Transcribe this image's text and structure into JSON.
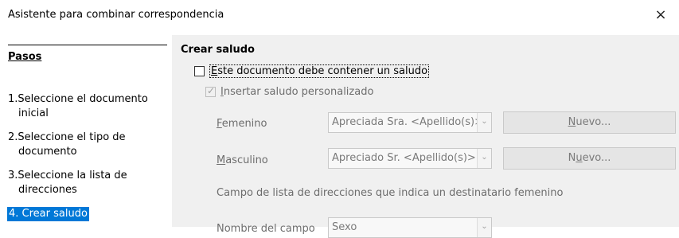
{
  "window": {
    "title": "Asistente para combinar correspondencia",
    "close_glyph": "×"
  },
  "sidebar": {
    "heading": "Pasos",
    "steps": [
      {
        "num": "1.",
        "line1": "Seleccione el documento",
        "line2": "inicial"
      },
      {
        "num": "2.",
        "line1": "Seleccione el tipo de",
        "line2": "documento"
      },
      {
        "num": "3.",
        "line1": "Seleccione la lista de",
        "line2": "direcciones"
      },
      {
        "num": "4.",
        "line1": "Crear saludo",
        "line2": ""
      }
    ],
    "active_step": 4,
    "active_color": "#0078d7"
  },
  "main": {
    "section_title": "Crear saludo",
    "greeting_checkbox": {
      "label_mnemonic": "E",
      "label_rest": "ste documento debe contener un saludo",
      "checked": false
    },
    "personalized_checkbox": {
      "label_mnemonic": "I",
      "label_rest": "nsertar saludo personalizado",
      "checked": true,
      "enabled": false
    },
    "female": {
      "label_mnemonic": "F",
      "label_rest": "emenino",
      "combo_value": "Apreciada Sra. <Apellido(s)>",
      "button_mnemonic": "N",
      "button_rest": "uevo..."
    },
    "male": {
      "label_mnemonic": "M",
      "label_rest": "asculino",
      "combo_value": "Apreciado Sr. <Apellido(s)>",
      "button_pre": "N",
      "button_mnemonic": "u",
      "button_rest": "evo..."
    },
    "field_caption": "Campo de lista de direcciones que indica un destinatario femenino",
    "field_name_label": "Nombre del campo",
    "field_name_value": "Sexo"
  }
}
